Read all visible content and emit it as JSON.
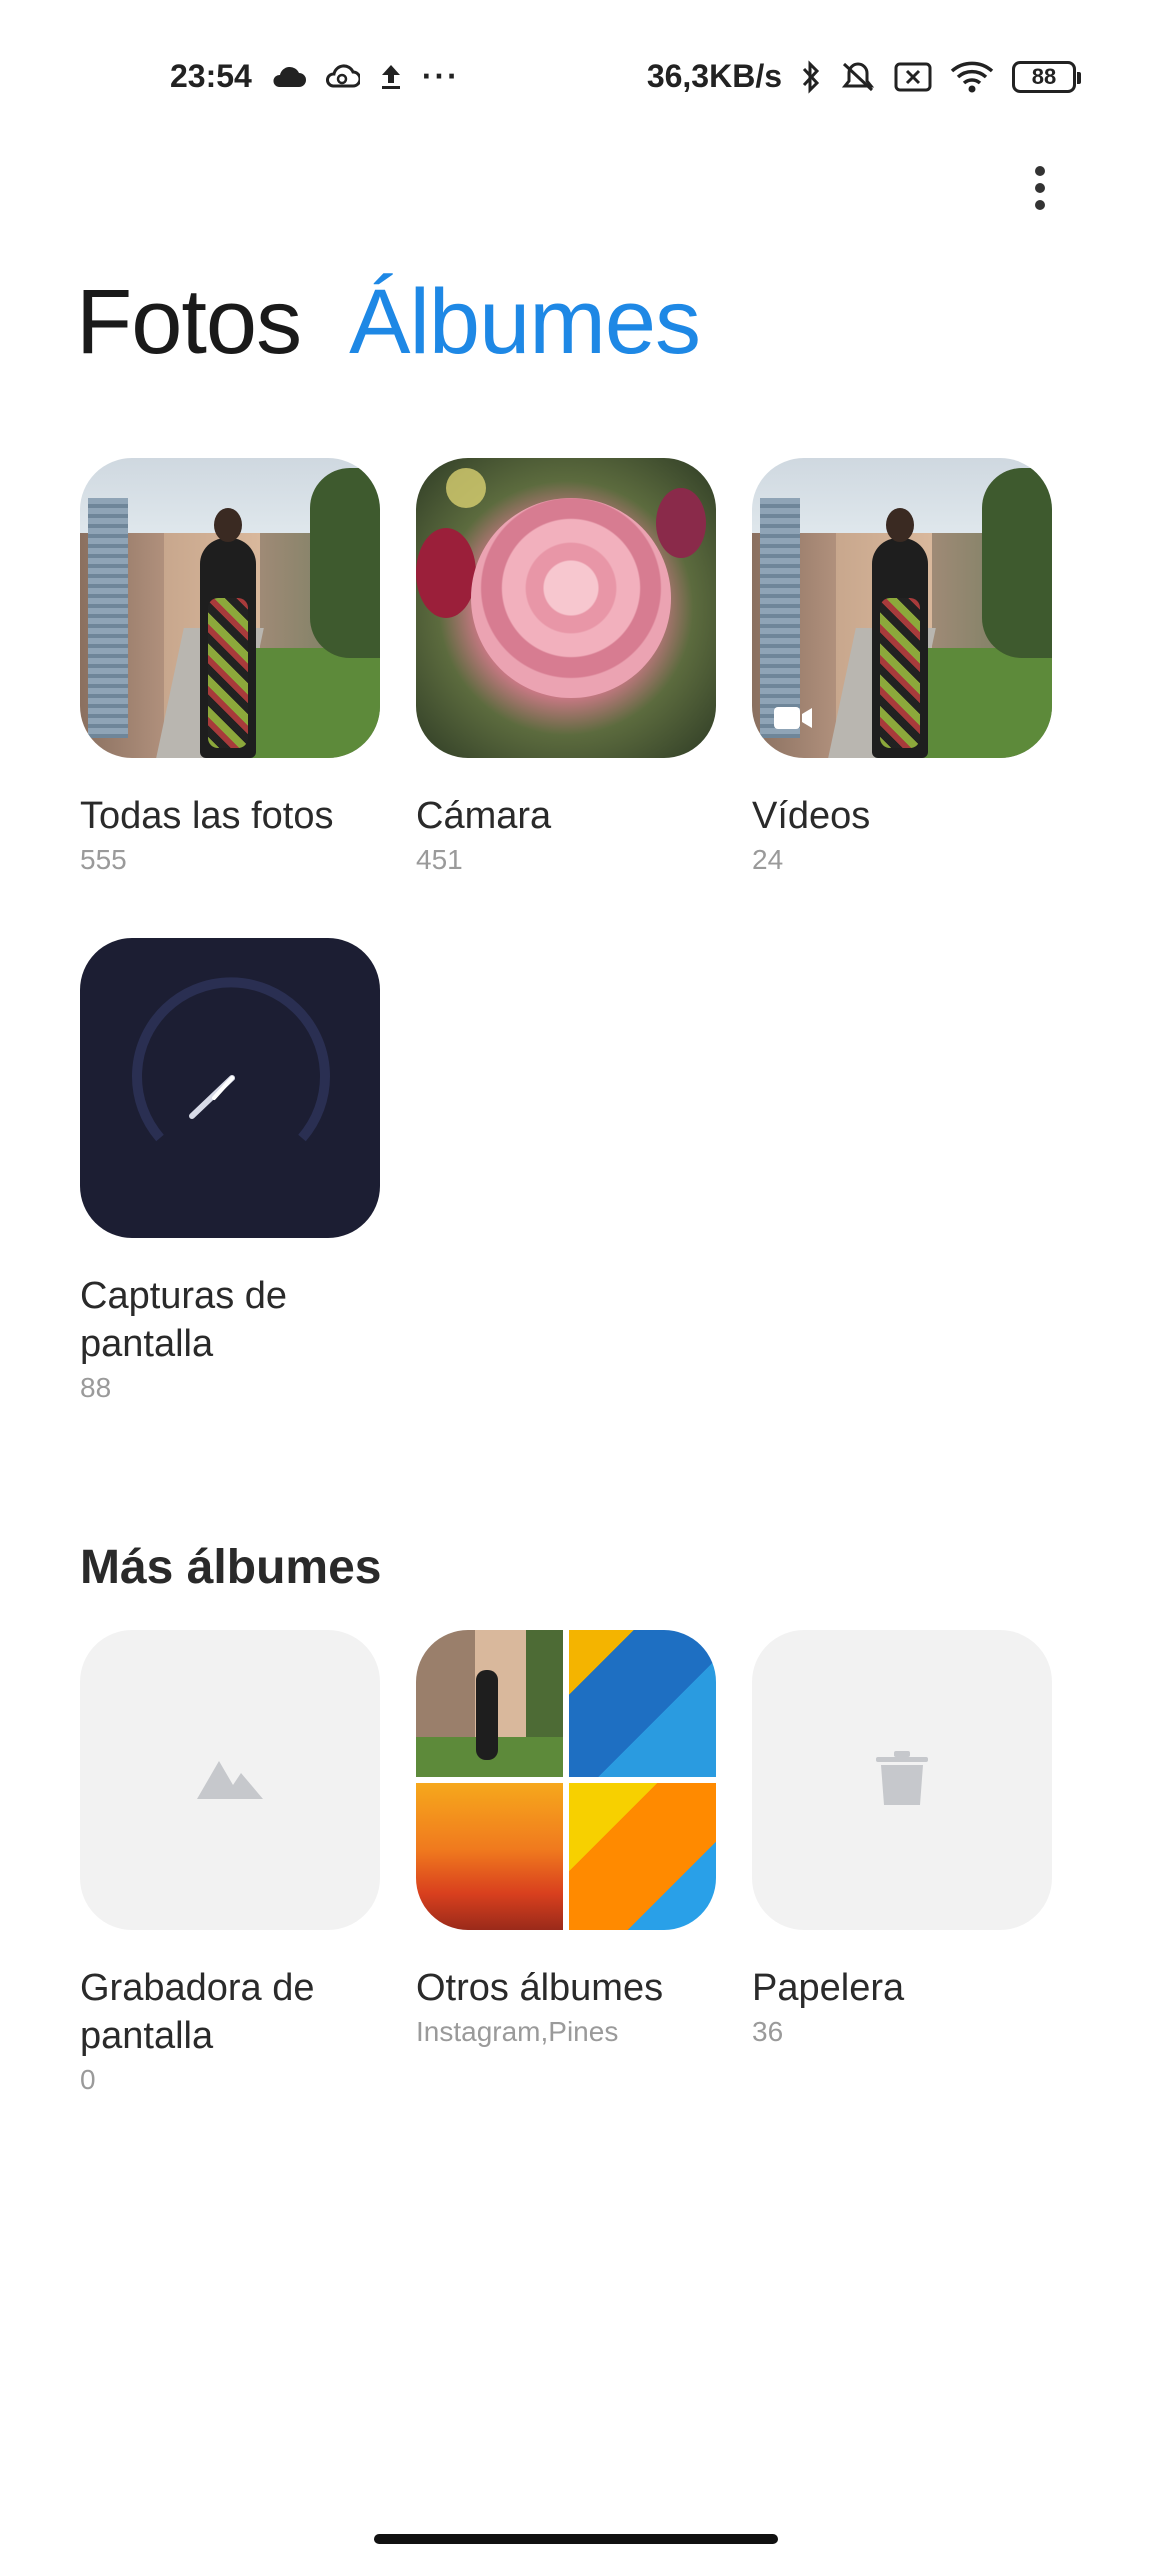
{
  "status_bar": {
    "time": "23:54",
    "left_icons": [
      "cloud-icon",
      "cloud-sync-icon",
      "upload-icon",
      "more-notifications-icon"
    ],
    "more_notifications": "···",
    "network_speed": "36,3KB/s",
    "right_icons": [
      "bluetooth-icon",
      "mute-icon",
      "no-sim-icon",
      "wifi-icon"
    ],
    "battery": "88"
  },
  "tabs": {
    "photos": "Fotos",
    "albums": "Álbumes",
    "active_color": "#1e88e5"
  },
  "albums": [
    {
      "title": "Todas las fotos",
      "count": "555"
    },
    {
      "title": "Cámara",
      "count": "451"
    },
    {
      "title": "Vídeos",
      "count": "24"
    },
    {
      "title": "Capturas de pantalla",
      "count": "88"
    }
  ],
  "more_albums": {
    "heading": "Más álbumes",
    "items": [
      {
        "title": "Grabadora de pantalla",
        "count": "0"
      },
      {
        "title": "Otros álbumes",
        "count": "Instagram,Pines"
      },
      {
        "title": "Papelera",
        "count": "36"
      }
    ]
  }
}
